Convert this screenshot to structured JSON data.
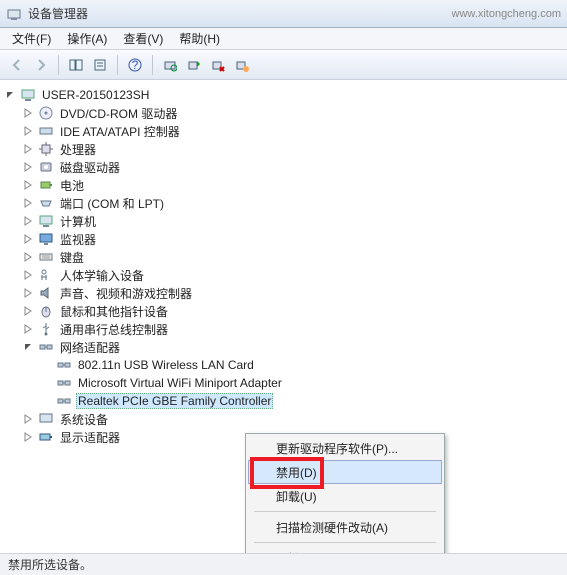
{
  "window": {
    "title": "设备管理器",
    "hidden_addr": "www.xitongcheng.com"
  },
  "menus": {
    "file": "文件(F)",
    "action": "操作(A)",
    "view": "查看(V)",
    "help": "帮助(H)"
  },
  "tree": {
    "root": "USER-20150123SH",
    "nodes": {
      "dvd": "DVD/CD-ROM 驱动器",
      "ide": "IDE ATA/ATAPI 控制器",
      "cpu": "处理器",
      "disk": "磁盘驱动器",
      "battery": "电池",
      "ports": "端口 (COM 和 LPT)",
      "computer": "计算机",
      "monitor": "监视器",
      "keyboard": "键盘",
      "hid": "人体学输入设备",
      "sound": "声音、视频和游戏控制器",
      "mouse": "鼠标和其他指针设备",
      "usb": "通用串行总线控制器",
      "netadapters": "网络适配器",
      "net1": "802.11n USB Wireless LAN Card",
      "net2": "Microsoft Virtual WiFi Miniport Adapter",
      "net3": "Realtek PCIe GBE Family Controller",
      "system": "系统设备",
      "display": "显示适配器"
    }
  },
  "context": {
    "update_driver": "更新驱动程序软件(P)...",
    "disable": "禁用(D)",
    "uninstall": "卸载(U)",
    "scan": "扫描检测硬件改动(A)",
    "properties": "属性(R)"
  },
  "status": "禁用所选设备。"
}
